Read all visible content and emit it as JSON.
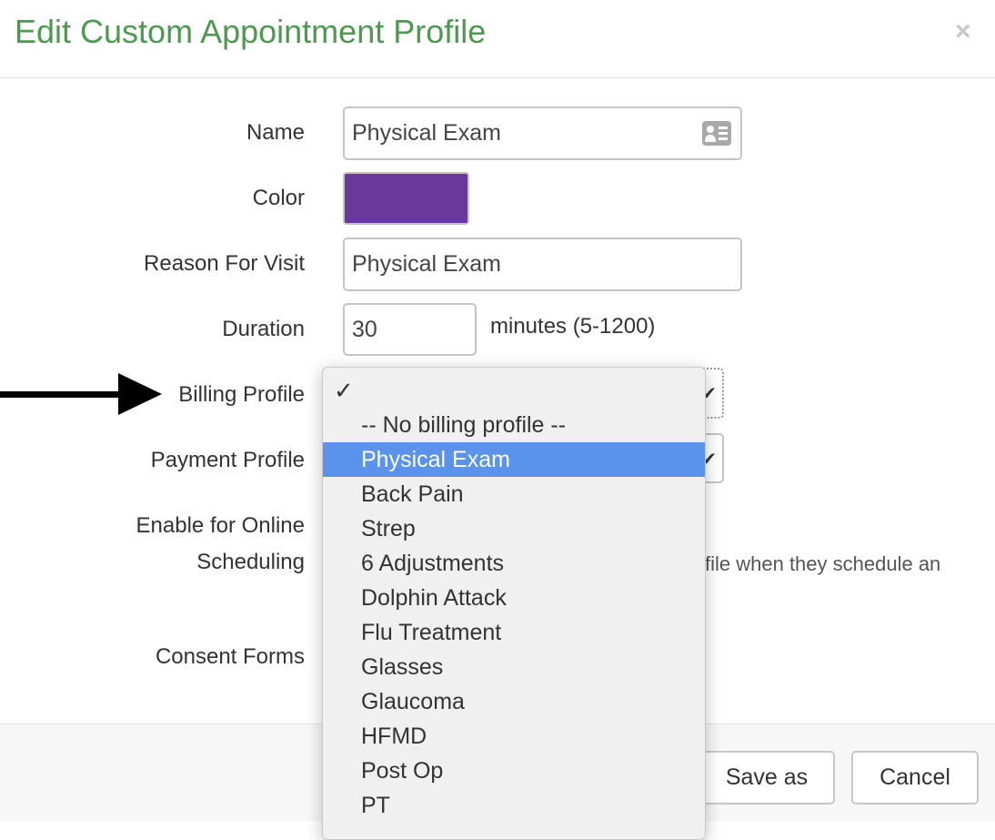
{
  "dialog": {
    "title": "Edit Custom Appointment Profile",
    "close_label": "×"
  },
  "form": {
    "name": {
      "label": "Name",
      "value": "Physical Exam",
      "icon": "contact-card-icon"
    },
    "color": {
      "label": "Color",
      "value": "#6a389c"
    },
    "reason": {
      "label": "Reason For Visit",
      "value": "Physical Exam"
    },
    "duration": {
      "label": "Duration",
      "value": "30",
      "unit": "minutes (5-1200)"
    },
    "billing": {
      "label": "Billing Profile"
    },
    "payment": {
      "label": "Payment Profile"
    },
    "online": {
      "label_line1": "Enable for Online",
      "label_line2": "Scheduling",
      "help_fragment": "file when they schedule an"
    },
    "consent": {
      "label": "Consent Forms"
    }
  },
  "dropdown": {
    "checkmark": "✓",
    "selected_index": 1,
    "options": [
      "-- No billing profile --",
      "Physical Exam",
      "Back Pain",
      "Strep",
      "6 Adjustments",
      "Dolphin Attack",
      "Flu Treatment",
      "Glasses",
      "Glaucoma",
      "HFMD",
      "Post Op",
      "PT"
    ]
  },
  "footer": {
    "save_as": "Save as",
    "cancel": "Cancel"
  }
}
